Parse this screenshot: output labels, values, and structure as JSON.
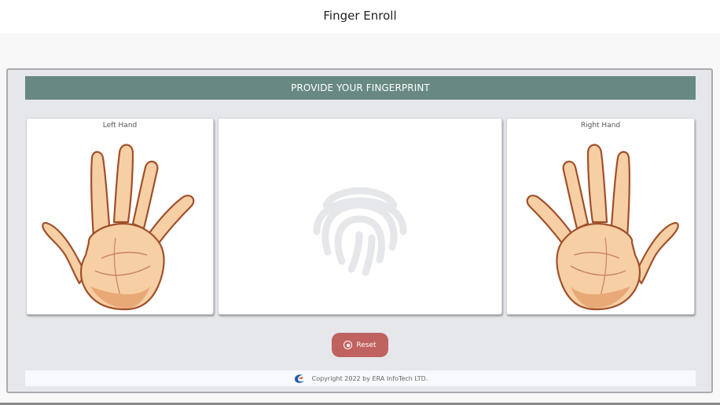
{
  "app": {
    "title": "Finger Enroll"
  },
  "banner": {
    "text": "PROVIDE YOUR FINGERPRINT"
  },
  "hands": {
    "left_label": "Left Hand",
    "right_label": "Right Hand"
  },
  "scanner": {
    "icon": "fingerprint-icon"
  },
  "actions": {
    "reset_label": "Reset",
    "reset_icon": "stop-circle-icon"
  },
  "footer": {
    "copyright": "Copyright 2022 by ERA InfoTech LTD.",
    "logo": "era-logo-icon"
  },
  "colors": {
    "banner": "#688982",
    "reset_button": "#c0625f",
    "panel_bg": "#e6e7ea",
    "skin": "#f7cfa4",
    "skin_outline": "#a0502a"
  }
}
